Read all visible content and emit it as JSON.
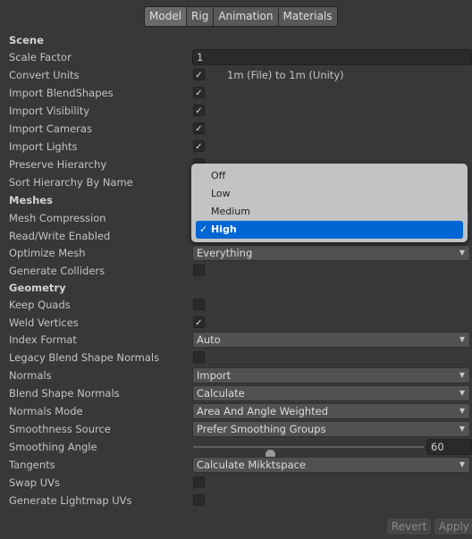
{
  "tabs": [
    "Model",
    "Rig",
    "Animation",
    "Materials"
  ],
  "active_tab": "Model",
  "rows": [
    {
      "label": "Scene",
      "type": "header"
    },
    {
      "label": "Scale Factor",
      "type": "field",
      "value": "1"
    },
    {
      "label": "Convert Units",
      "type": "check",
      "checked": true,
      "note": "1m (File) to 1m (Unity)"
    },
    {
      "label": "Import BlendShapes",
      "type": "check",
      "checked": true
    },
    {
      "label": "Import Visibility",
      "type": "check",
      "checked": true
    },
    {
      "label": "Import Cameras",
      "type": "check",
      "checked": true
    },
    {
      "label": "Import Lights",
      "type": "check",
      "checked": true
    },
    {
      "label": "Preserve Hierarchy",
      "type": "check",
      "checked": false
    },
    {
      "label": "Sort Hierarchy By Name",
      "type": "check",
      "checked": true
    },
    {
      "label": "Meshes",
      "type": "header"
    },
    {
      "label": "Mesh Compression",
      "type": "dropdown",
      "value": "High"
    },
    {
      "label": "Read/Write Enabled",
      "type": "check",
      "checked": false
    },
    {
      "label": "Optimize Mesh",
      "type": "dropdown",
      "value": "Everything"
    },
    {
      "label": "Generate Colliders",
      "type": "check",
      "checked": false
    },
    {
      "label": "Geometry",
      "type": "header"
    },
    {
      "label": "Keep Quads",
      "type": "check",
      "checked": false
    },
    {
      "label": "Weld Vertices",
      "type": "check",
      "checked": true
    },
    {
      "label": "Index Format",
      "type": "dropdown",
      "value": "Auto"
    },
    {
      "label": "Legacy Blend Shape Normals",
      "type": "check",
      "checked": false
    },
    {
      "label": "Normals",
      "type": "dropdown",
      "value": "Import"
    },
    {
      "label": "Blend Shape Normals",
      "type": "dropdown",
      "value": "Calculate"
    },
    {
      "label": "Normals Mode",
      "type": "dropdown",
      "value": "Area And Angle Weighted"
    },
    {
      "label": "Smoothness Source",
      "type": "dropdown",
      "value": "Prefer Smoothing Groups"
    },
    {
      "label": "Smoothing Angle",
      "type": "slider",
      "value": "60",
      "min": 0,
      "max": 180
    },
    {
      "label": "Tangents",
      "type": "dropdown",
      "value": "Calculate Mikktspace"
    },
    {
      "label": "Swap UVs",
      "type": "check",
      "checked": false
    },
    {
      "label": "Generate Lightmap UVs",
      "type": "check",
      "checked": false
    }
  ],
  "popup": {
    "options": [
      "Off",
      "Low",
      "Medium",
      "High"
    ],
    "selected": "High",
    "check_glyph": "✓"
  },
  "check_glyph": "✓",
  "dropdown_arrow": "▼",
  "buttons": {
    "revert": "Revert",
    "apply": "Apply"
  },
  "colors": {
    "background": "#383838",
    "selection": "#0066d4",
    "popup": "#c2c3c5"
  }
}
